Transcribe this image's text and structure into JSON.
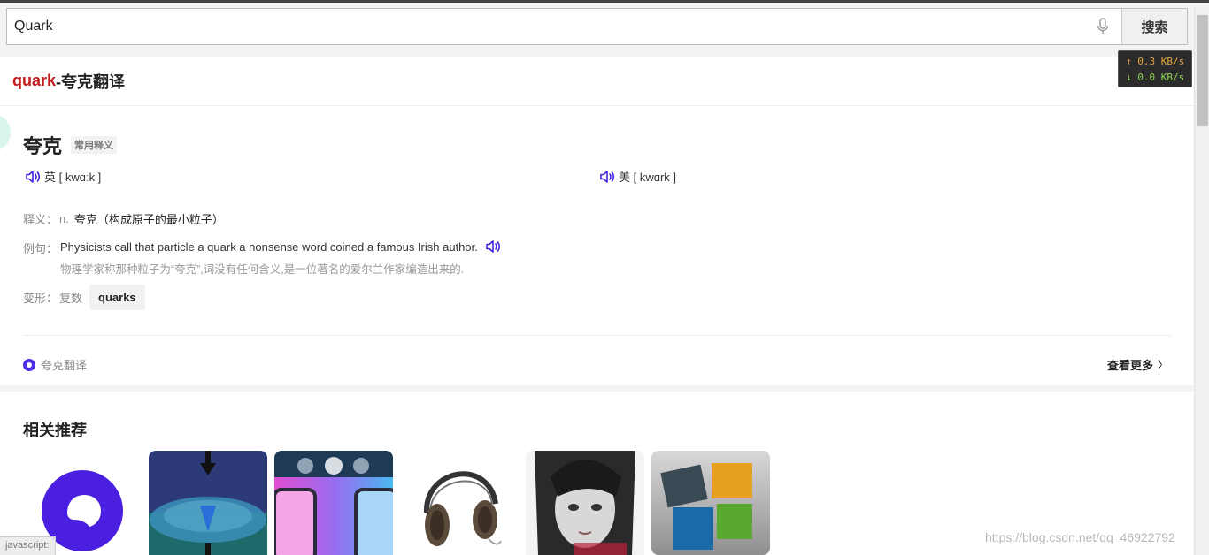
{
  "search": {
    "query": "Quark",
    "button_label": "搜索"
  },
  "netmon": {
    "up": "↑ 0.3 KB/s",
    "down": "↓ 0.0 KB/s"
  },
  "card": {
    "header_keyword": "quark",
    "header_suffix": "-夸克翻译",
    "word": "夸克",
    "tag": "常用释义",
    "pron_uk": "英 [ kwɑːk ]",
    "pron_us": "美 [ kwɑrk ]",
    "definition": {
      "label": "释义：",
      "pos": "n.",
      "text": "夸克（构成原子的最小粒子）"
    },
    "example": {
      "label": "例句：",
      "en": "Physicists call that particle a quark a nonsense word coined a famous Irish author.",
      "zh": "物理学家称那种粒子为“夸克”,词没有任何含义,是一位著名的爱尔兰作家编造出来的."
    },
    "variant": {
      "label": "变形：",
      "type": "复数",
      "value": "quarks"
    },
    "source": "夸克翻译",
    "more": "查看更多",
    "more_chevron": "〉"
  },
  "recommend": {
    "title": "相关推荐"
  },
  "statusbar": "javascript:",
  "watermark": "https://blog.csdn.net/qq_46922792",
  "icons": [
    "mic-icon",
    "speaker-icon",
    "quark-logo-icon",
    "chevron-right-icon"
  ],
  "colors": {
    "keyword": "#c31d1d",
    "accent": "#4a2ee8",
    "speaker": "#3f27d8"
  }
}
